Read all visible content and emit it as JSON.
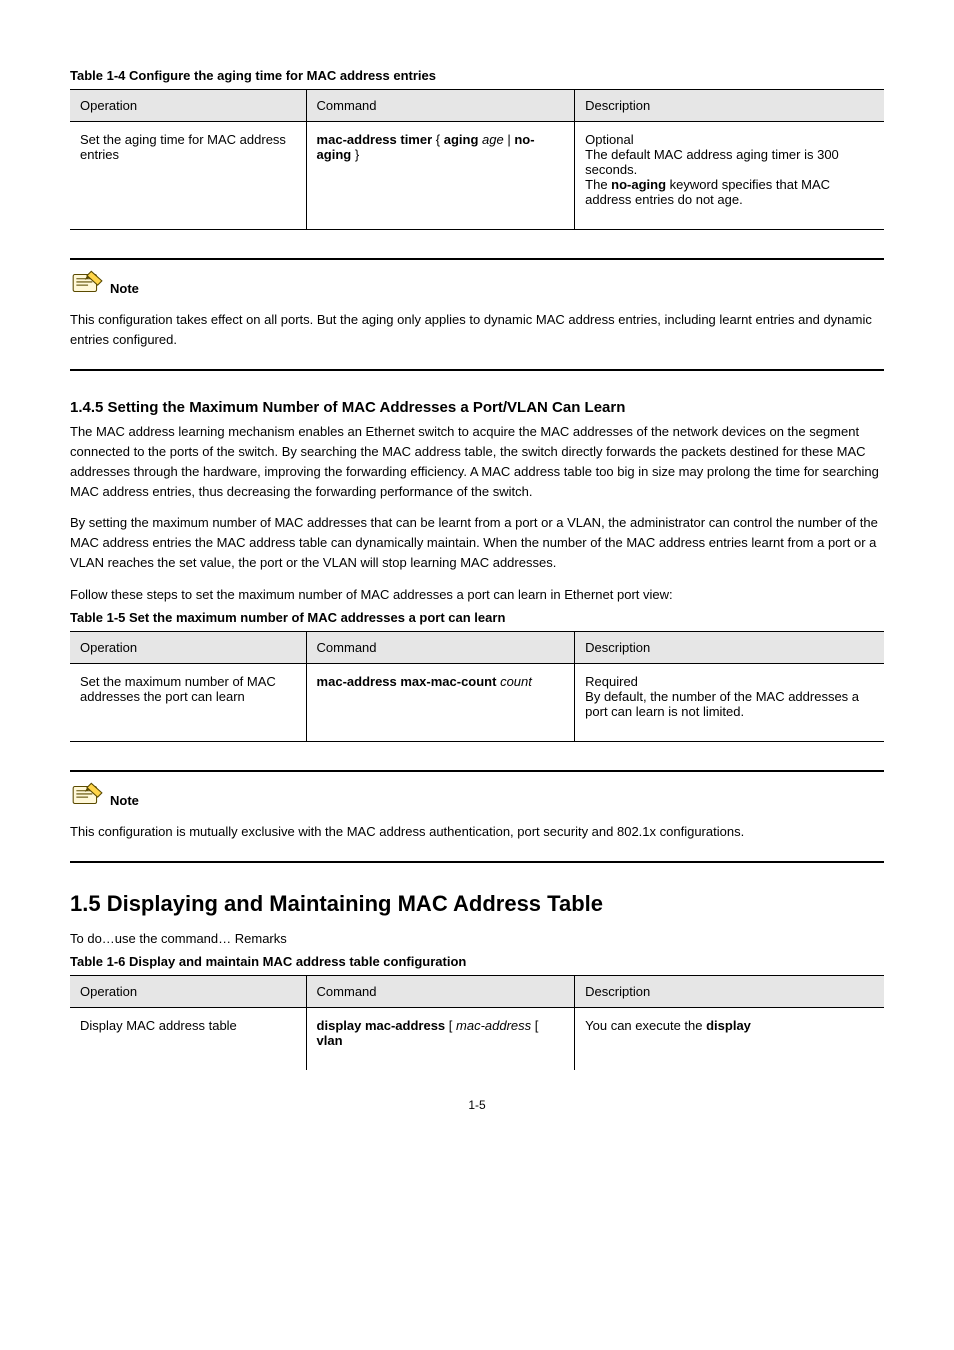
{
  "tables": {
    "t1": {
      "caption": "Table 1-4 Configure the aging time for MAC address entries",
      "headers": [
        "Operation",
        "Command",
        "Description"
      ],
      "row": {
        "op": "Set the aging time for MAC address entries",
        "cmd_bold1": "mac-address timer",
        "cmd_plain1": " { ",
        "cmd_bold2": "aging",
        "cmd_plain2": " ",
        "cmd_italic1": "age",
        "cmd_plain3": " | ",
        "cmd_bold3": "no-aging",
        "cmd_plain4": " }",
        "desc_line1": "Optional",
        "desc_line2": "The default MAC address aging timer is 300 seconds.",
        "desc_line3_pre": "The ",
        "desc_line3_bold": "no-aging",
        "desc_line3_post": " keyword specifies that MAC address entries do not age."
      }
    },
    "t2": {
      "caption": "Table 1-5 Set the maximum number of MAC addresses a port can learn",
      "headers": [
        "Operation",
        "Command",
        "Description"
      ],
      "row": {
        "op": "Set the maximum number of MAC addresses the port can learn",
        "cmd_bold1": "mac-address max-mac-count",
        "cmd_plain1": " ",
        "cmd_italic1": "count",
        "desc_line1": "Required",
        "desc_line2": "By default, the number of the MAC addresses a port can learn is not limited."
      }
    },
    "t3": {
      "caption": "Table 1-6 Display and maintain MAC address table configuration",
      "headers": [
        "Operation",
        "Command",
        "Description"
      ],
      "row": {
        "op": "Display MAC address table",
        "cmd_bold1": "display mac-address",
        "cmd_plain1": " [ ",
        "cmd_italic1": "mac-address",
        "cmd_plain2": " [ ",
        "cmd_bold2": "vlan",
        "desc_pre": "You can execute the ",
        "desc_bold": "display",
        "desc_post": ""
      }
    }
  },
  "note1": "This configuration takes effect on all ports. But the aging only applies to dynamic MAC address entries, including learnt entries and dynamic entries configured.",
  "note2": "This configuration is mutually exclusive with the MAC address authentication, port security and 802.1x configurations.",
  "section": {
    "h1_5": "1.4.5  Setting the Maximum Number of MAC Addresses a Port/VLAN Can Learn",
    "p1": "The MAC address learning mechanism enables an Ethernet switch to acquire the MAC addresses of the network devices on the segment connected to the ports of the switch. By searching the MAC address table, the switch directly forwards the packets destined for these MAC addresses through the hardware, improving the forwarding efficiency. A MAC address table too big in size may prolong the time for searching MAC address entries, thus decreasing the forwarding performance of the switch.",
    "p2": "By setting the maximum number of MAC addresses that can be learnt from a port or a VLAN, the administrator can control the number of the MAC address entries the MAC address table can dynamically maintain. When the number of the MAC address entries learnt from a port or a VLAN reaches the set value, the port or the VLAN will stop learning MAC addresses.",
    "follow1": "Follow these steps to set the maximum number of MAC addresses a port can learn in Ethernet port view:",
    "h1_6": "1.5  Displaying and Maintaining MAC Address Table",
    "follow2": "To do…use the command…  Remarks"
  },
  "pageno": "1-5"
}
